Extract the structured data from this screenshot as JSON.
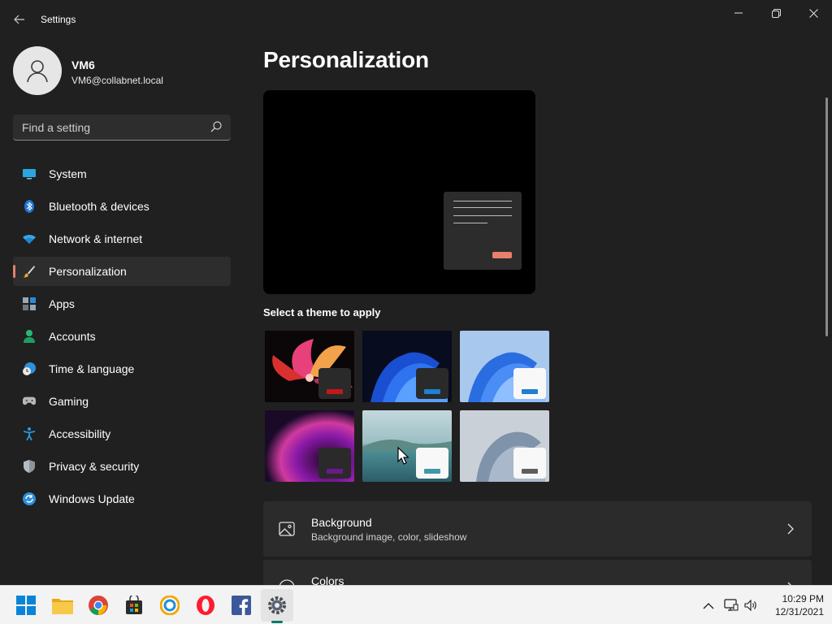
{
  "window": {
    "title": "Settings",
    "back_icon": "back-arrow-icon",
    "controls": [
      "minimize-icon",
      "restore-icon",
      "close-icon"
    ]
  },
  "profile": {
    "name": "VM6",
    "email": "VM6@collabnet.local"
  },
  "search": {
    "placeholder": "Find a setting",
    "icon": "search-icon"
  },
  "sidebar": {
    "selected": "Personalization",
    "items": [
      {
        "label": "System",
        "icon": "system-monitor-icon"
      },
      {
        "label": "Bluetooth & devices",
        "icon": "bluetooth-icon"
      },
      {
        "label": "Network & internet",
        "icon": "wifi-icon"
      },
      {
        "label": "Personalization",
        "icon": "paintbrush-icon"
      },
      {
        "label": "Apps",
        "icon": "apps-grid-icon"
      },
      {
        "label": "Accounts",
        "icon": "person-icon"
      },
      {
        "label": "Time & language",
        "icon": "globe-clock-icon"
      },
      {
        "label": "Gaming",
        "icon": "gamepad-icon"
      },
      {
        "label": "Accessibility",
        "icon": "accessibility-icon"
      },
      {
        "label": "Privacy & security",
        "icon": "shield-icon"
      },
      {
        "label": "Windows Update",
        "icon": "update-icon"
      }
    ]
  },
  "main": {
    "title": "Personalization",
    "preview": {
      "background": "#000000",
      "accent": "#e8806a"
    },
    "themes_label": "Select a theme to apply",
    "themes": [
      {
        "name": "glow-flower",
        "accent": "#c41818",
        "window": "dark"
      },
      {
        "name": "bloom-dark",
        "accent": "#1f7fd1",
        "window": "dark"
      },
      {
        "name": "bloom-light",
        "accent": "#1f7fd1",
        "window": "light"
      },
      {
        "name": "glow-purple",
        "accent": "#6b1a8c",
        "window": "dark"
      },
      {
        "name": "captured-motion-lake",
        "accent": "#3f98a8",
        "window": "light"
      },
      {
        "name": "flow-silver",
        "accent": "#5e5e5e",
        "window": "light"
      }
    ],
    "cards": [
      {
        "title": "Background",
        "subtitle": "Background image, color, slideshow",
        "icon": "image-icon"
      },
      {
        "title": "Colors",
        "subtitle": "",
        "icon": "palette-icon"
      }
    ]
  },
  "taskbar": {
    "apps": [
      {
        "name": "start-icon"
      },
      {
        "name": "file-explorer-icon"
      },
      {
        "name": "chrome-icon"
      },
      {
        "name": "store-icon"
      },
      {
        "name": "browser-icon"
      },
      {
        "name": "opera-icon"
      },
      {
        "name": "facebook-icon"
      },
      {
        "name": "settings-icon",
        "active": true
      }
    ],
    "tray": [
      "chevron-up-icon",
      "network-icon",
      "volume-icon"
    ],
    "time": "10:29 PM",
    "date": "12/31/2021"
  }
}
